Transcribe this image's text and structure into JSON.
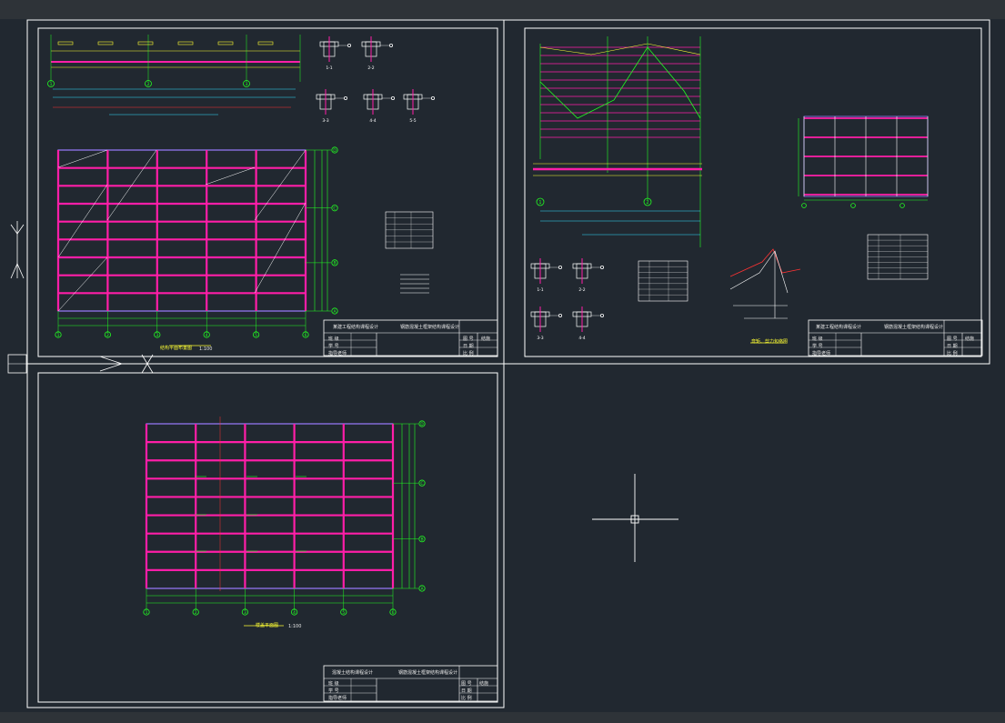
{
  "app": {
    "name": "CAD drawing viewer",
    "colors": {
      "background": "#212830",
      "frame": "#ffffff",
      "beam": "#ff1ea8",
      "dimension": "#22ff22",
      "yellow": "#ffff33",
      "cyan": "#33e0ff",
      "text": "#e8e8e8",
      "purple": "#9a7cff",
      "red": "#ff3333"
    }
  },
  "sheets": [
    {
      "id": "sheet-1",
      "title_block": {
        "school": "某建工程结构课程设计",
        "project": "钢筋混凝土框架结构课程设计",
        "row_labels": [
          "班 级",
          "学 号",
          "指导老师"
        ],
        "right_labels": [
          "图 号",
          "日 期",
          "比 例"
        ],
        "right_value": "结施"
      },
      "plan_caption": "结构平面布置图",
      "plan_scale": "1:100",
      "axis_labels_x": [
        "1",
        "2",
        "3",
        "4",
        "5",
        "6"
      ],
      "axis_labels_y": [
        "D",
        "C",
        "B",
        "A"
      ],
      "section_labels": [
        "1-1",
        "2-2",
        "3-3",
        "4-4",
        "5-5"
      ],
      "elevation_axes": [
        "1",
        "2",
        "3"
      ]
    },
    {
      "id": "sheet-2",
      "title_block": {
        "school": "某建工程结构课程设计",
        "project": "钢筋混凝土框架结构课程设计",
        "row_labels": [
          "班 级",
          "学 号",
          "指导老师"
        ],
        "right_labels": [
          "图 号",
          "日 期",
          "比 例"
        ],
        "right_value": "结施"
      },
      "diagram_caption": "弯矩、剪力包络图",
      "section_labels": [
        "1-1",
        "2-2",
        "3-3",
        "4-4"
      ],
      "axis_labels": [
        "1",
        "2"
      ]
    },
    {
      "id": "sheet-3",
      "title_block": {
        "school": "混凝土结构课程设计",
        "project": "钢筋混凝土框架结构课程设计",
        "row_labels": [
          "班 级",
          "学 号",
          "指导老师"
        ],
        "right_labels": [
          "图 号",
          "日 期",
          "比 例"
        ],
        "right_value": "结施"
      },
      "plan_caption": "楼盖平面图",
      "plan_scale": "1:100",
      "axis_labels_x": [
        "1",
        "2",
        "3",
        "4",
        "5",
        "6"
      ],
      "axis_labels_y": [
        "D",
        "C",
        "B",
        "A"
      ]
    }
  ]
}
